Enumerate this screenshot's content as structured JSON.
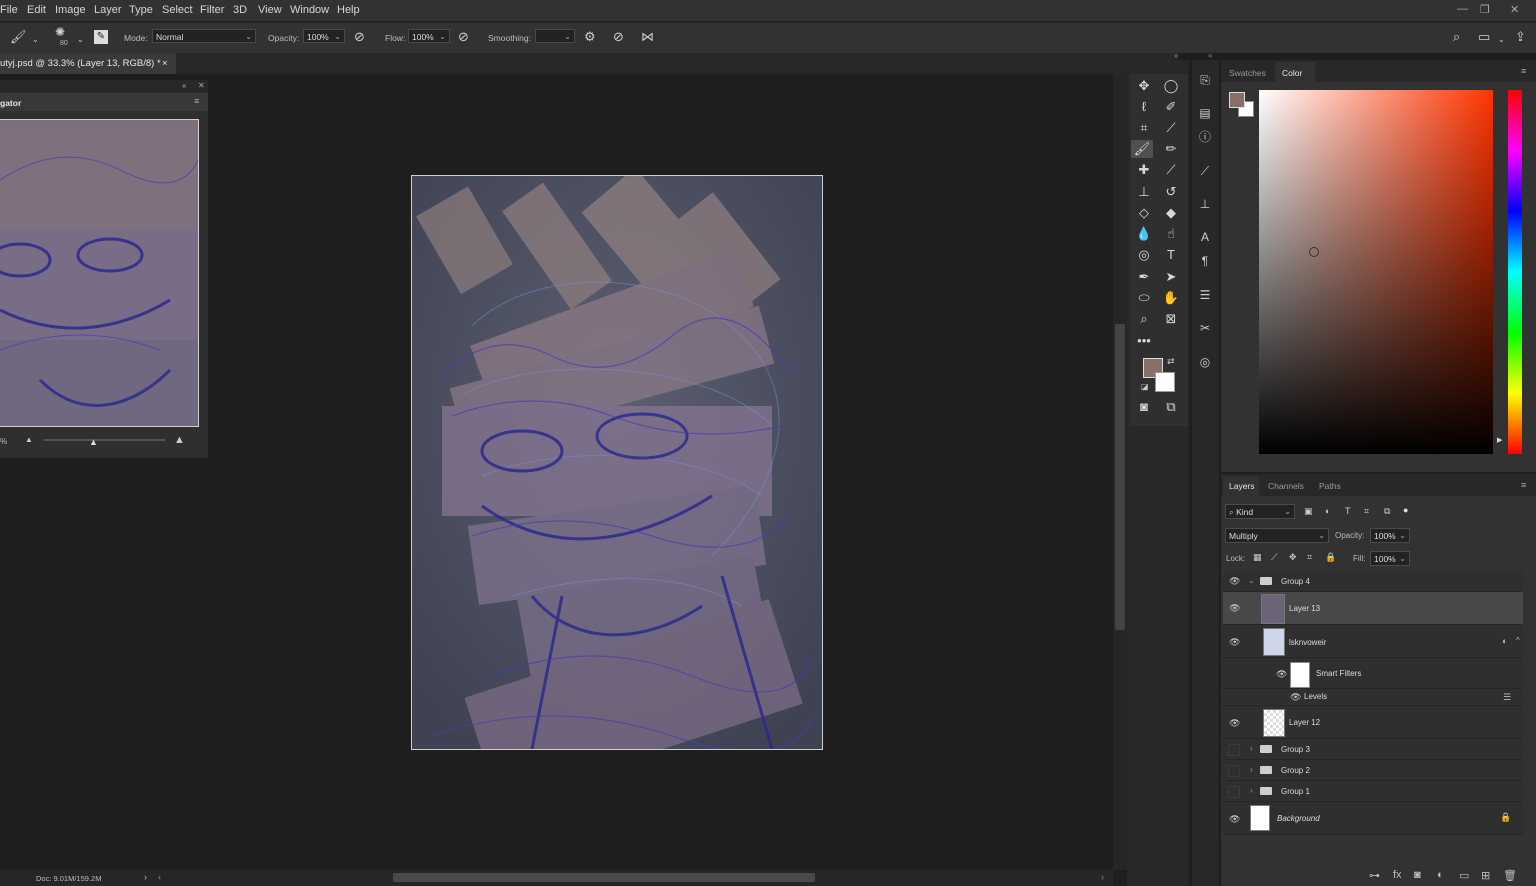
{
  "menu": [
    "File",
    "Edit",
    "Image",
    "Layer",
    "Type",
    "Select",
    "Filter",
    "3D",
    "View",
    "Window",
    "Help"
  ],
  "options": {
    "brush_size": "80",
    "mode_label": "Mode:",
    "mode_value": "Normal",
    "opacity_label": "Opacity:",
    "opacity_value": "100%",
    "flow_label": "Flow:",
    "flow_value": "100%",
    "smoothing_label": "Smoothing:",
    "smoothing_value": ""
  },
  "document": {
    "tab_title": "utyj.psd @ 33.3% (Layer 13, RGB/8) *",
    "close": "×"
  },
  "navigator": {
    "title": "gator",
    "zoom_text": "%"
  },
  "status": {
    "doc_info": "Doc: 9.01M/159.2M"
  },
  "color_panel": {
    "tabs": [
      "Swatches",
      "Color"
    ],
    "active_tab": "Color",
    "foreground": "#8a6e69",
    "background": "#ffffff"
  },
  "layers_panel": {
    "tabs": [
      "Layers",
      "Channels",
      "Paths"
    ],
    "active_tab": "Layers",
    "filter_kind": "Kind",
    "blend_mode": "Multiply",
    "opacity_label": "Opacity:",
    "opacity_value": "100%",
    "lock_label": "Lock:",
    "fill_label": "Fill:",
    "fill_value": "100%",
    "layers": {
      "group4": "Group 4",
      "layer13": "Layer 13",
      "smart": "lsknvoweir",
      "smart_filters": "Smart Filters",
      "levels": "Levels",
      "layer12": "Layer 12",
      "group3": "Group 3",
      "group2": "Group 2",
      "group1": "Group 1",
      "background": "Background"
    }
  }
}
